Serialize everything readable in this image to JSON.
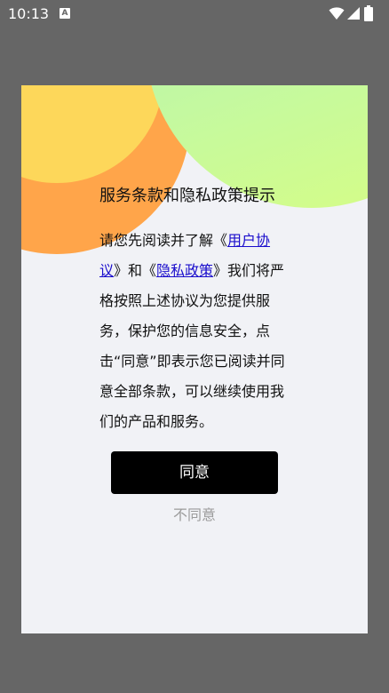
{
  "status_bar": {
    "time": "10:13",
    "notification_icon_letter": "A",
    "icons": [
      "notification-a-icon",
      "wifi-icon",
      "cellular-signal-icon",
      "battery-icon"
    ]
  },
  "dialog": {
    "title": "服务条款和隐私政策提示",
    "body": {
      "text_1": "请您先阅读并了解《",
      "link_user_agreement": "用户协议",
      "text_2": "》和《",
      "link_privacy_policy": "隐私政策",
      "text_3": "》我们将严格按照上述协议为您提供服务，保护您的信息安全，点击“同意”即表示您已阅读并同意全部条款，可以继续使用我们的产品和服务。"
    },
    "agree_label": "同意",
    "disagree_label": "不同意"
  },
  "colors": {
    "backdrop": "#666666",
    "dialog_background": "#f1f2f6",
    "circle_orange": "#ffa54a",
    "circle_yellow": "#fdd75a",
    "circle_green": "#c4f9a0",
    "link": "#1a0dcc",
    "agree_button": "#000000",
    "disagree_text": "#9b9b9b"
  }
}
